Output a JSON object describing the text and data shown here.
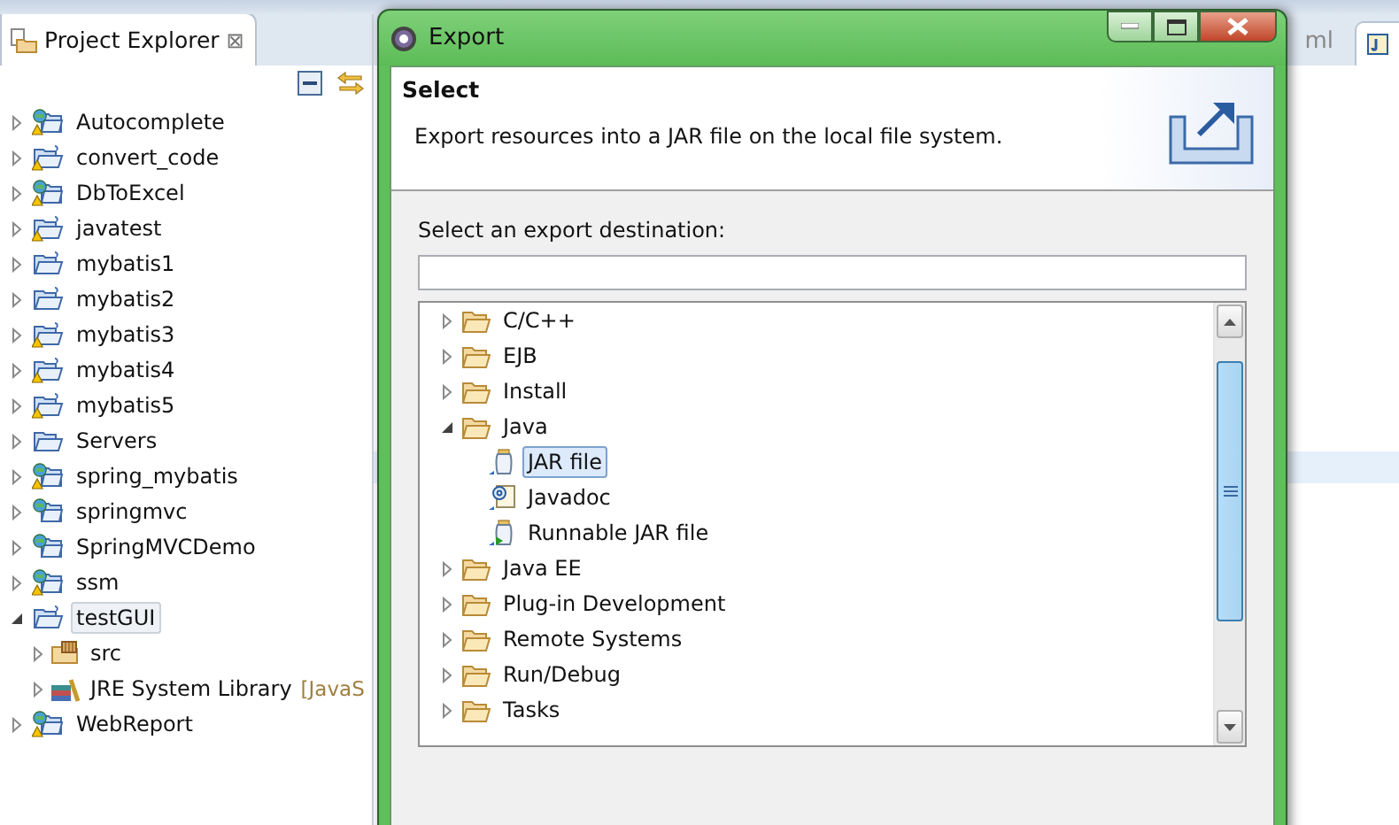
{
  "explorer": {
    "title": "Project Explorer",
    "close": "⊠",
    "projects": [
      {
        "name": "Autocomplete",
        "kind": "web",
        "warning": true,
        "expanded": false,
        "selected": false
      },
      {
        "name": "convert_code",
        "kind": "java",
        "warning": true,
        "expanded": false,
        "selected": false
      },
      {
        "name": "DbToExcel",
        "kind": "web",
        "warning": true,
        "expanded": false,
        "selected": false
      },
      {
        "name": "javatest",
        "kind": "java",
        "warning": true,
        "expanded": false,
        "selected": false
      },
      {
        "name": "mybatis1",
        "kind": "java",
        "warning": false,
        "expanded": false,
        "selected": false
      },
      {
        "name": "mybatis2",
        "kind": "java",
        "warning": false,
        "expanded": false,
        "selected": false
      },
      {
        "name": "mybatis3",
        "kind": "java",
        "warning": true,
        "expanded": false,
        "selected": false
      },
      {
        "name": "mybatis4",
        "kind": "java",
        "warning": true,
        "expanded": false,
        "selected": false
      },
      {
        "name": "mybatis5",
        "kind": "java",
        "warning": true,
        "expanded": false,
        "selected": false
      },
      {
        "name": "Servers",
        "kind": "folder",
        "warning": false,
        "expanded": false,
        "selected": false
      },
      {
        "name": "spring_mybatis",
        "kind": "web",
        "warning": true,
        "expanded": false,
        "selected": false
      },
      {
        "name": "springmvc",
        "kind": "web",
        "warning": false,
        "expanded": false,
        "selected": false
      },
      {
        "name": "SpringMVCDemo",
        "kind": "web",
        "warning": false,
        "expanded": false,
        "selected": false
      },
      {
        "name": "ssm",
        "kind": "web",
        "warning": true,
        "expanded": false,
        "selected": false
      },
      {
        "name": "testGUI",
        "kind": "java",
        "warning": false,
        "expanded": true,
        "selected": true,
        "children": [
          {
            "name": "src",
            "kind": "package",
            "expanded": false,
            "selected": false
          },
          {
            "name": "JRE System Library",
            "kind": "library",
            "decoration": "[JavaS",
            "expanded": false,
            "selected": false
          }
        ]
      },
      {
        "name": "WebReport",
        "kind": "web",
        "warning": true,
        "expanded": false,
        "selected": false
      }
    ]
  },
  "editor": {
    "tab_fragment": "ml"
  },
  "dialog": {
    "title": "Export",
    "heading": "Select",
    "description": "Export resources into a JAR file on the local file system.",
    "filter_label": "Select an export destination:",
    "wizards": [
      {
        "name": "C/C++",
        "kind": "folder",
        "expanded": false,
        "selected": false
      },
      {
        "name": "EJB",
        "kind": "folder",
        "expanded": false,
        "selected": false
      },
      {
        "name": "Install",
        "kind": "folder",
        "expanded": false,
        "selected": false
      },
      {
        "name": "Java",
        "kind": "folder",
        "expanded": true,
        "selected": false,
        "children": [
          {
            "name": "JAR file",
            "kind": "jar",
            "selected": true
          },
          {
            "name": "Javadoc",
            "kind": "javadoc",
            "selected": false
          },
          {
            "name": "Runnable JAR file",
            "kind": "runnable",
            "selected": false
          }
        ]
      },
      {
        "name": "Java EE",
        "kind": "folder",
        "expanded": false,
        "selected": false
      },
      {
        "name": "Plug-in Development",
        "kind": "folder",
        "expanded": false,
        "selected": false
      },
      {
        "name": "Remote Systems",
        "kind": "folder",
        "expanded": false,
        "selected": false
      },
      {
        "name": "Run/Debug",
        "kind": "folder",
        "expanded": false,
        "selected": false
      },
      {
        "name": "Tasks",
        "kind": "folder",
        "expanded": false,
        "selected": false
      }
    ]
  }
}
